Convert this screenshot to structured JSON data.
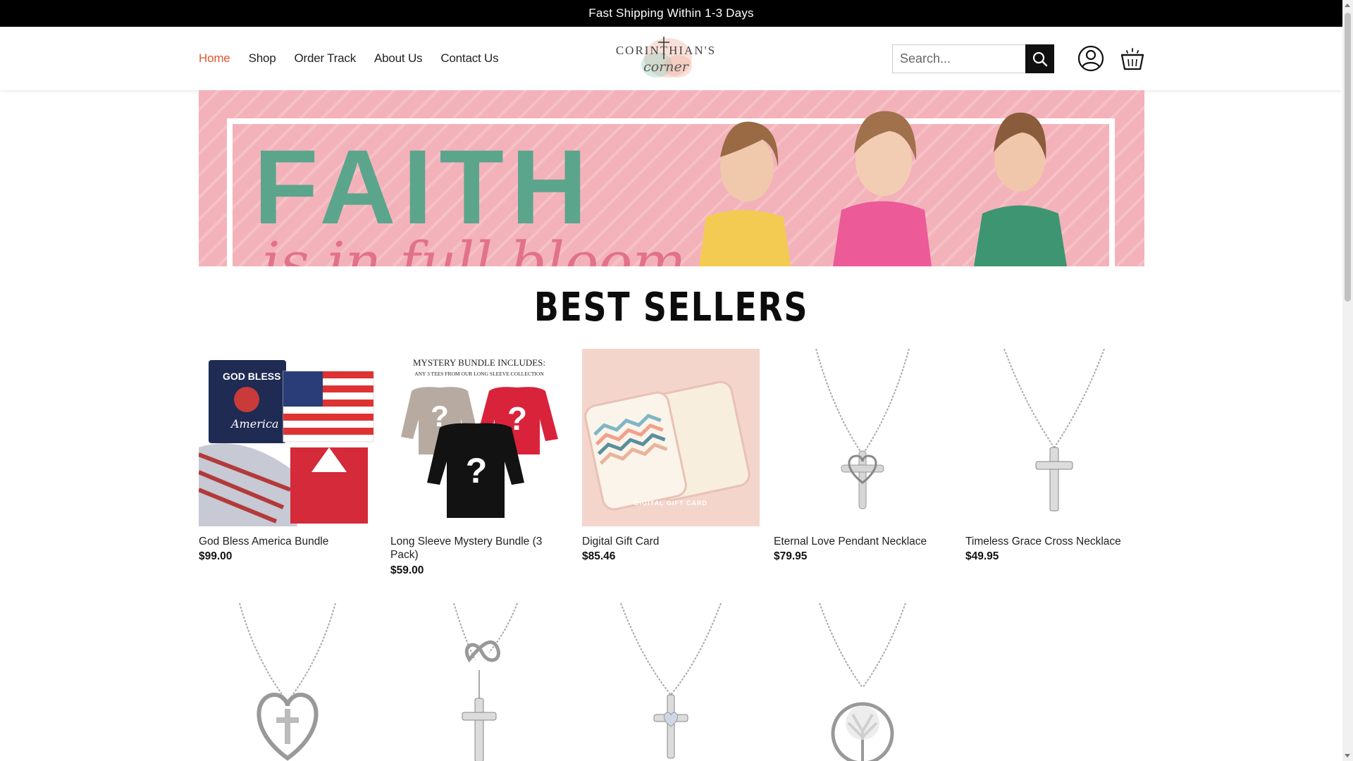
{
  "announcement": "Fast Shipping Within 1-3 Days",
  "nav": {
    "items": [
      "Home",
      "Shop",
      "Order Track",
      "About Us",
      "Contact Us"
    ],
    "active": "Home"
  },
  "logo": {
    "brand": "CORINTHIAN'S",
    "script": "corner"
  },
  "search": {
    "placeholder": "Search..."
  },
  "hero": {
    "title": "FAITH",
    "subtitle": "is in full bloom"
  },
  "section_title": "BEST SELLERS",
  "products": [
    {
      "name": "God Bless America Bundle",
      "price": "$99.00"
    },
    {
      "name": "Long Sleeve Mystery Bundle (3 Pack)",
      "price": "$59.00"
    },
    {
      "name": "Digital Gift Card",
      "price": "$85.46"
    },
    {
      "name": "Eternal Love Pendant Necklace",
      "price": "$79.95"
    },
    {
      "name": "Timeless Grace Cross Necklace",
      "price": "$49.95"
    }
  ],
  "product_images": {
    "bundle_text_1": "GOD BLESS",
    "bundle_text_2": "America",
    "mystery_heading": "MYSTERY BUNDLE INCLUDES:",
    "mystery_sub": "ANY 3 TEES FROM OUR LONG SLEEVE COLLECTION",
    "giftcard_label": "DIGITAL GIFT CARD"
  },
  "icons": {
    "search": "search-icon",
    "account": "user-icon",
    "cart": "cart-icon"
  },
  "colors": {
    "accent": "#e4572e",
    "topbar": "#000000",
    "hero_pink": "#f3b2ba",
    "hero_green": "#5ba58c"
  }
}
